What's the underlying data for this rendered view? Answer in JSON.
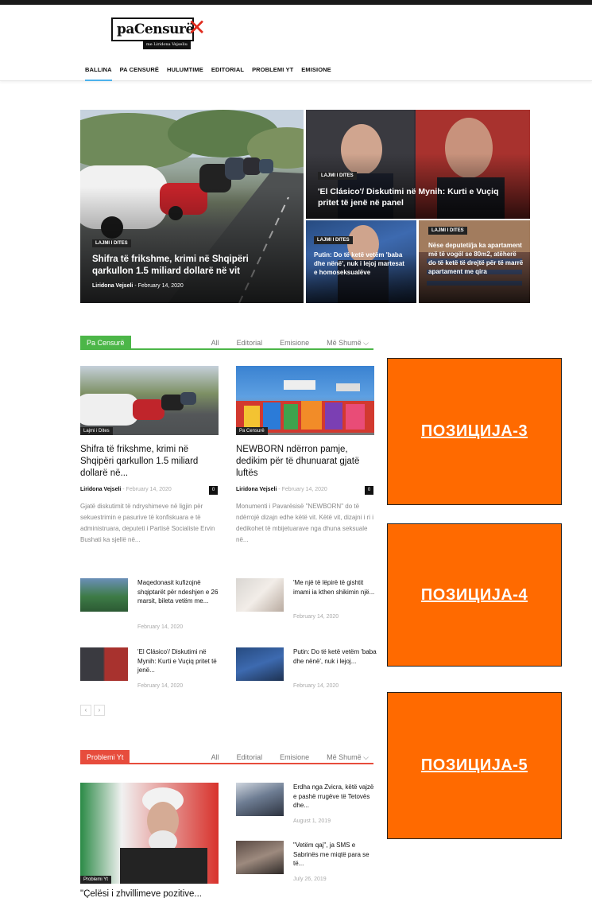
{
  "site": {
    "logo_text": "paCensurë",
    "logo_x": "✕",
    "logo_tagline": "me Liridona Vejseliu"
  },
  "nav": [
    "BALLINA",
    "PA CENSURË",
    "HULUMTIME",
    "EDITORIAL",
    "PROBLEMI YT",
    "EMISIONE"
  ],
  "hero": {
    "main": {
      "badge": "LAJMI I DITES",
      "title": "Shifra të frikshme, krimi në Shqipëri qarkullon 1.5 miliard dollarë në vit",
      "author": "Liridona Vejseli",
      "separator": "-",
      "date": "February 14, 2020"
    },
    "top_right": {
      "badge": "LAJMI I DITES",
      "title": "'El Clásico'/ Diskutimi në Mynih: Kurti e Vuçiq pritet të jenë në panel"
    },
    "bottom_left": {
      "badge": "LAJMI I DITES",
      "title": "Putin: Do të ketë vetëm 'baba dhe nënë', nuk i lejoj martesat e homoseksualëve"
    },
    "bottom_right": {
      "badge": "LAJMI I DITES",
      "title": "Nëse deputeti/ja ka apartament më të vogël se 80m2, atëherë do të ketë të drejtë për të marrë apartament me qira"
    }
  },
  "block1": {
    "label": "Pa Censurë",
    "color": "#4cb648",
    "filters": [
      "All",
      "Editorial",
      "Emisione",
      "Më Shumë ⌵"
    ],
    "cards": [
      {
        "badge": "Lajmi i Dites",
        "title": "Shifra të frikshme, krimi në Shqipëri qarkullon 1.5 miliard dollarë në...",
        "author": "Liridona Vejseli",
        "date": "February 14, 2020",
        "comments": "0",
        "excerpt": "Gjatë diskutimit të ndryshimeve në ligjin për sekuestrimin e pasurive të konfiskuara e të administruara, deputeti i Partisë Socialiste Ervin Bushati ka sjellë në..."
      },
      {
        "badge": "Pa Censurë",
        "title": "NEWBORN ndërron pamje, dedikim për të dhunuarat gjatë luftës",
        "author": "Liridona Vejseli",
        "date": "February 14, 2020",
        "comments": "0",
        "excerpt": "Monumenti i Pavarësisë \"NEWBORN\" do të ndërrojë dizajn edhe këtë vit. Këtë vit, dizajni i ri i dedikohet të mbijetuarave nga dhuna seksuale në..."
      }
    ],
    "minis": [
      {
        "title": "Maqedonasit kufizojnë shqiptarët për ndeshjen e 26 marsit, bileta vetëm me...",
        "date": "February 14, 2020"
      },
      {
        "title": "'Me një të lëpirë të gishtit imami ia kthen shikimin një...",
        "date": "February 14, 2020"
      },
      {
        "title": "'El Clásico'/ Diskutimi në Mynih: Kurti e Vuçiq pritet të jenë...",
        "date": "February 14, 2020"
      },
      {
        "title": "Putin: Do të ketë vetëm 'baba dhe nënë', nuk i lejoj...",
        "date": "February 14, 2020"
      }
    ],
    "prev": "‹",
    "next": "›"
  },
  "block2": {
    "label": "Problemi Yt",
    "color": "#e74c3c",
    "filters": [
      "All",
      "Editorial",
      "Emisione",
      "Më Shumë ⌵"
    ],
    "card": {
      "badge": "Problemi Yt",
      "title": "\"Çelësi i zhvillimeve pozitive..."
    },
    "minis": [
      {
        "title": "Erdha nga Zvicra, këtë vajzë e pashë rrugëve të Tetovës dhe...",
        "date": "August 1, 2019"
      },
      {
        "title": "\"Vetëm qaj\", ja SMS e Sabrinës me miqtë para se të...",
        "date": "July 26, 2019"
      }
    ]
  },
  "ads": [
    "ПОЗИЦИЈА-3",
    "ПОЗИЦИЈА-4",
    "ПОЗИЦИЈА-5"
  ]
}
